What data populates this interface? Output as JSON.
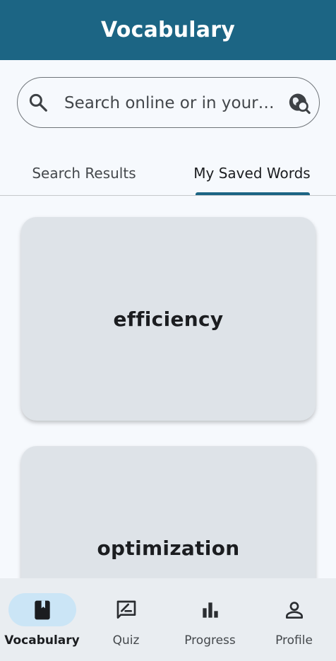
{
  "app_bar": {
    "title": "Vocabulary"
  },
  "search": {
    "placeholder": "Search online or in your ...",
    "leading_icon": "search-icon",
    "trailing_icon": "travel-explore-icon"
  },
  "tabs": [
    {
      "label": "Search Results",
      "selected": false
    },
    {
      "label": "My Saved Words",
      "selected": true
    }
  ],
  "saved_words": [
    {
      "word": "efficiency"
    },
    {
      "word": "optimization"
    }
  ],
  "bottom_nav": [
    {
      "label": "Vocabulary",
      "icon": "book-icon",
      "active": true
    },
    {
      "label": "Quiz",
      "icon": "rate-review-icon",
      "active": false
    },
    {
      "label": "Progress",
      "icon": "bar-chart-icon",
      "active": false
    },
    {
      "label": "Profile",
      "icon": "person-icon",
      "active": false
    }
  ],
  "colors": {
    "primary": "#1c6584",
    "background": "#f6f9fd",
    "card": "#dee3e8",
    "nav_background": "#e9edf1",
    "nav_active_pill": "#cbe5f6"
  }
}
